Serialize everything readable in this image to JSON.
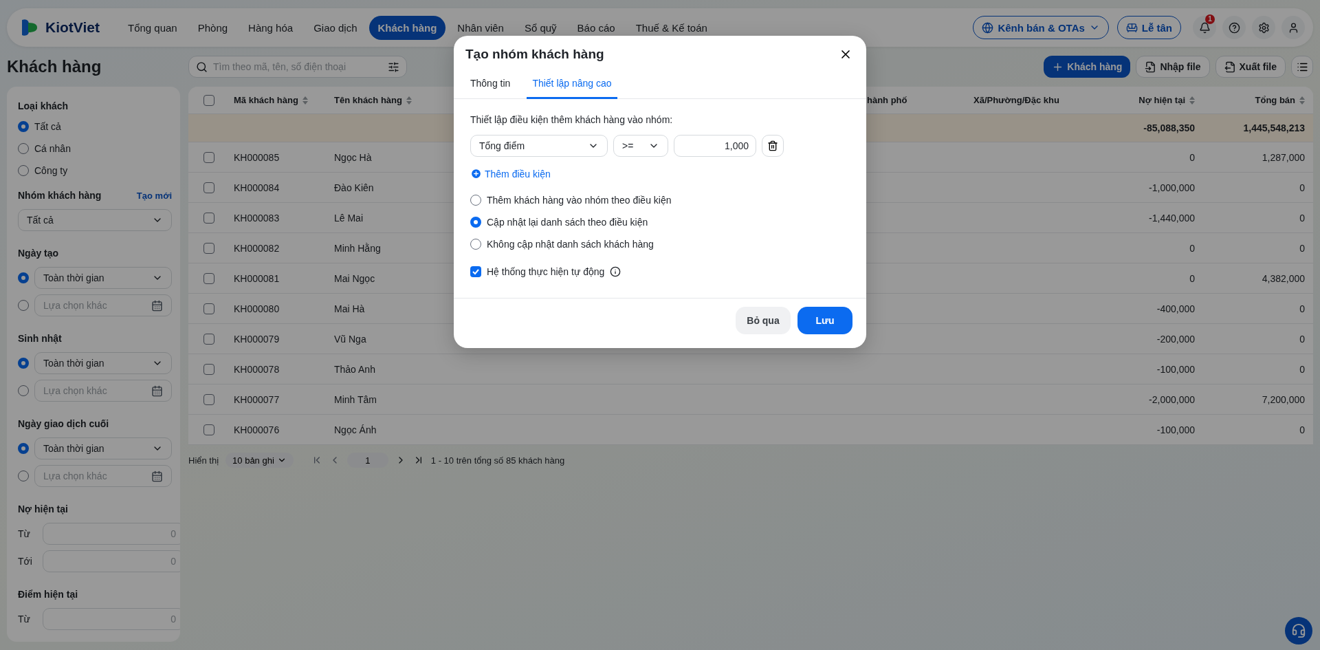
{
  "nav": {
    "brand": "KiotViet",
    "items": [
      {
        "label": "Tổng quan",
        "selected": false
      },
      {
        "label": "Phòng",
        "selected": false
      },
      {
        "label": "Hàng hóa",
        "selected": false
      },
      {
        "label": "Giao dịch",
        "selected": false
      },
      {
        "label": "Khách hàng",
        "selected": true
      },
      {
        "label": "Nhân viên",
        "selected": false
      },
      {
        "label": "Sổ quỹ",
        "selected": false
      },
      {
        "label": "Báo cáo",
        "selected": false
      },
      {
        "label": "Thuế & Kế toán",
        "selected": false
      }
    ],
    "channels_button": "Kênh bán & OTAs",
    "reception_button": "Lễ tân",
    "notification_count": "1"
  },
  "page_title": "Khách hàng",
  "filters": {
    "customer_type": {
      "label": "Loại khách",
      "options": [
        {
          "label": "Tất cả",
          "selected": true
        },
        {
          "label": "Cá nhân",
          "selected": false
        },
        {
          "label": "Công ty",
          "selected": false
        }
      ]
    },
    "customer_group": {
      "label": "Nhóm khách hàng",
      "link": "Tạo mới",
      "value": "Tất cả"
    },
    "date_filters": [
      {
        "label": "Ngày tạo",
        "preset": "Toàn thời gian",
        "custom_placeholder": "Lựa chọn khác",
        "preset_selected": true
      },
      {
        "label": "Sinh nhật",
        "preset": "Toàn thời gian",
        "custom_placeholder": "Lựa chọn khác",
        "preset_selected": true
      },
      {
        "label": "Ngày giao dịch cuối",
        "preset": "Toàn thời gian",
        "custom_placeholder": "Lựa chọn khác",
        "preset_selected": true
      }
    ],
    "ranges": [
      {
        "label": "Nợ hiện tại",
        "fields": [
          {
            "label": "Từ",
            "placeholder": "0"
          },
          {
            "label": "Tới",
            "placeholder": "0"
          }
        ]
      },
      {
        "label": "Điểm hiện tại",
        "fields": [
          {
            "label": "Từ",
            "placeholder": "0"
          }
        ]
      }
    ]
  },
  "search": {
    "placeholder": "Tìm theo mã, tên, số điện thoại"
  },
  "actions": [
    {
      "kind": "add",
      "label": "Khách hàng"
    },
    {
      "kind": "import",
      "label": "Nhập file"
    },
    {
      "kind": "export",
      "label": "Xuất file"
    }
  ],
  "table": {
    "all_checked": false,
    "columns": [
      {
        "label": "Mã khách hàng",
        "sortable": true
      },
      {
        "label": "Tên khách hàng",
        "sortable": true
      },
      {
        "label": "hành phố",
        "sortable": false
      },
      {
        "label": "Xã/Phường/Đặc khu",
        "sortable": false
      },
      {
        "label": "Nợ hiện tại",
        "sortable": true
      },
      {
        "label": "Tổng bán",
        "sortable": true
      }
    ],
    "summary": {
      "debt": "-85,088,350",
      "total_sales": "1,445,548,213"
    },
    "rows": [
      {
        "code": "KH000085",
        "name": "Ngọc Hà",
        "debt": "0",
        "total_sales": "1,287,000",
        "checked": false
      },
      {
        "code": "KH000084",
        "name": "Đào Kiên",
        "debt": "-1,000,000",
        "total_sales": "0",
        "checked": false
      },
      {
        "code": "KH000083",
        "name": "Lê Mai",
        "debt": "-1,440,000",
        "total_sales": "0",
        "checked": false
      },
      {
        "code": "KH000082",
        "name": "Minh Hằng",
        "debt": "0",
        "total_sales": "0",
        "checked": false
      },
      {
        "code": "KH000081",
        "name": "Mai Ngọc",
        "debt": "0",
        "total_sales": "4,382,000",
        "checked": false
      },
      {
        "code": "KH000080",
        "name": "Mai Hà",
        "debt": "-400,000",
        "total_sales": "0",
        "checked": false
      },
      {
        "code": "KH000079",
        "name": "Vũ Nga",
        "debt": "-200,000",
        "total_sales": "0",
        "checked": false
      },
      {
        "code": "KH000078",
        "name": "Thảo Anh",
        "debt": "-100,000",
        "total_sales": "0",
        "checked": false
      },
      {
        "code": "KH000077",
        "name": "Minh Tâm",
        "debt": "-2,000,000",
        "total_sales": "7,200,000",
        "checked": false
      },
      {
        "code": "KH000076",
        "name": "Ngọc Ánh",
        "debt": "-100,000",
        "total_sales": "0",
        "checked": false
      }
    ]
  },
  "pagination": {
    "label": "Hiển thị",
    "page_size": "10 bản ghi",
    "page": "1",
    "summary": "1 - 10 trên tổng số 85 khách hàng"
  },
  "dialog": {
    "title": "Tạo nhóm khách hàng",
    "tabs": [
      {
        "label": "Thông tin",
        "selected": false
      },
      {
        "label": "Thiết lập nâng cao",
        "selected": true
      }
    ],
    "instruction": "Thiết lập điều kiện thêm khách hàng vào nhóm:",
    "conditions": [
      {
        "field": "Tổng điểm",
        "operator": ">=",
        "value": "1,000"
      }
    ],
    "add_condition": "Thêm điều kiện",
    "modes": [
      {
        "label": "Thêm khách hàng vào nhóm theo điều kiện",
        "selected": false
      },
      {
        "label": "Cập nhật lại danh sách theo điều kiện",
        "selected": true
      },
      {
        "label": "Không cập nhật danh sách khách hàng",
        "selected": false
      }
    ],
    "auto": {
      "label": "Hệ thống thực hiện tự động",
      "checked": true
    },
    "cancel_button": "Bỏ qua",
    "save_button": "Lưu"
  }
}
